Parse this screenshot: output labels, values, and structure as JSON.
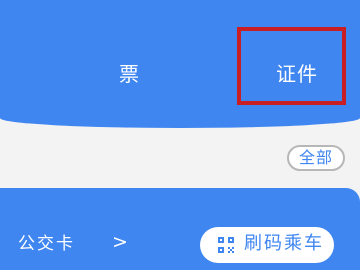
{
  "tabs": {
    "tickets": "票",
    "documents": "证件"
  },
  "filter": {
    "all_label": "全部"
  },
  "card": {
    "title": "公交卡",
    "chevron": ">",
    "ride_button_label": "刷码乘车"
  },
  "icons": {
    "qr": "qr-code-icon"
  },
  "colors": {
    "primary_blue": "#3f86f0",
    "highlight_red": "#c81e24",
    "background": "#f3f3f3"
  }
}
